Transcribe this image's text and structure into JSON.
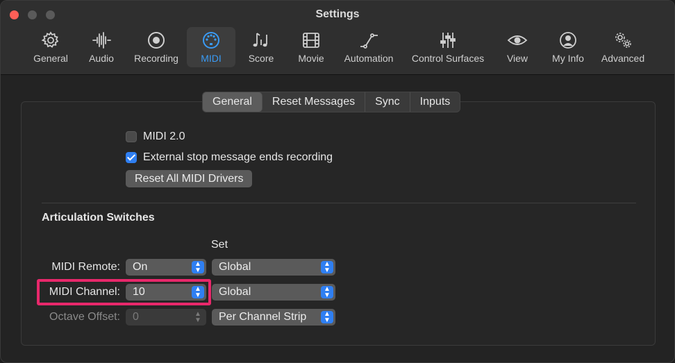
{
  "window": {
    "title": "Settings"
  },
  "toolbar": {
    "items": [
      {
        "label": "General",
        "icon": "gear-icon"
      },
      {
        "label": "Audio",
        "icon": "waveform-icon"
      },
      {
        "label": "Recording",
        "icon": "record-icon"
      },
      {
        "label": "MIDI",
        "icon": "midi-port-icon",
        "active": true
      },
      {
        "label": "Score",
        "icon": "music-notes-icon"
      },
      {
        "label": "Movie",
        "icon": "film-icon"
      },
      {
        "label": "Automation",
        "icon": "automation-curve-icon"
      },
      {
        "label": "Control Surfaces",
        "icon": "faders-icon"
      },
      {
        "label": "View",
        "icon": "eye-icon"
      },
      {
        "label": "My Info",
        "icon": "person-icon"
      },
      {
        "label": "Advanced",
        "icon": "gears-icon"
      }
    ],
    "accent_color": "#3a9bf5"
  },
  "tabs": {
    "items": [
      "General",
      "Reset Messages",
      "Sync",
      "Inputs"
    ],
    "selected": "General"
  },
  "general": {
    "midi2_label": "MIDI 2.0",
    "midi2_checked": false,
    "external_stop_label": "External stop message ends recording",
    "external_stop_checked": true,
    "reset_button_label": "Reset All MIDI Drivers"
  },
  "articulation": {
    "title": "Articulation Switches",
    "set_header": "Set",
    "rows": [
      {
        "label": "MIDI Remote:",
        "value": "On",
        "set": "Global"
      },
      {
        "label": "MIDI Channel:",
        "value": "10",
        "set": "Global"
      },
      {
        "label": "Octave Offset:",
        "value": "0",
        "set": "Per Channel Strip",
        "value_disabled": true
      }
    ]
  },
  "highlight_color": "#e8286b"
}
